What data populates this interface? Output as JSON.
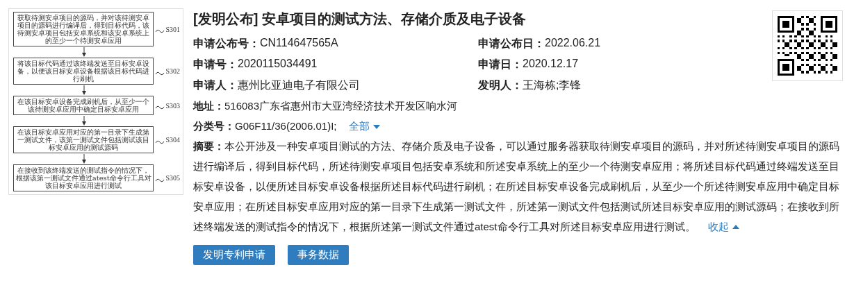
{
  "figure": {
    "steps": [
      {
        "text": "获取待测安卓项目的源码，并对该待测安卓项目的源码进行编译后，得到目标代码，该待测安卓项目包括安卓系统和该安卓系统上的至少一个待测安卓应用",
        "label": "S301"
      },
      {
        "text": "将该目标代码通过该终端发送至目标安卓设备，以便该目标安卓设备根据该目标代码进行刷机",
        "label": "S302"
      },
      {
        "text": "在该目标安卓设备完成刷机后，从至少一个该待测安卓应用中确定目标安卓应用",
        "label": "S303"
      },
      {
        "text": "在该目标安卓应用对应的第一目录下生成第一测试文件，该第一测试文件包括测试该目标安卓应用的测试源码",
        "label": "S304"
      },
      {
        "text": "在接收到该终端发送的测试指令的情况下，根据该第一测试文件通过atest命令行工具对该目标安卓应用进行测试",
        "label": "S305"
      }
    ]
  },
  "title": "[发明公布] 安卓项目的测试方法、存储介质及电子设备",
  "rows": [
    [
      {
        "label": "申请公布号：",
        "value": "CN114647565A"
      },
      {
        "label": "申请公布日：",
        "value": "2022.06.21"
      }
    ],
    [
      {
        "label": "申请号：",
        "value": "2020115034491"
      },
      {
        "label": "申请日：",
        "value": "2020.12.17"
      }
    ],
    [
      {
        "label": "申请人：",
        "value": "惠州比亚迪电子有限公司"
      },
      {
        "label": "发明人：",
        "value": "王海栋;李锋"
      }
    ]
  ],
  "address": {
    "label": "地址：",
    "value": "516083广东省惠州市大亚湾经济技术开发区响水河"
  },
  "classification": {
    "label": "分类号：",
    "value": "G06F11/36(2006.01)I;",
    "toggle": {
      "text": "全部",
      "expanded": false
    }
  },
  "abstract": {
    "text": "**摘要：**本公开涉及一种安卓项目测试的方法、存储介质及电子设备，可以通过服务器获取待测安卓项目的源码，并对所述待测安卓项目的源码进行编译后，得到目标代码，所述待测安卓项目包括安卓系统和所述安卓系统上的至少一个待测安卓应用；将所述目标代码通过终端发送至目标安卓设备，以便所述目标安卓设备根据所述目标代码进行刷机；在所述目标安卓设备完成刷机后，从至少一个所述待测安卓应用中确定目标安卓应用；在所述目标安卓应用对应的第一目录下生成第一测试文件，所述第一测试文件包括测试所述目标安卓应用的测试源码；在接收到所述终端发送的测试指令的情况下，根据所述第一测试文件通过atest命令行工具对所述目标安卓应用进行测试。",
    "toggle": {
      "text": "收起",
      "expanded": true
    }
  },
  "buttons": [
    "发明专利申请",
    "事务数据"
  ]
}
